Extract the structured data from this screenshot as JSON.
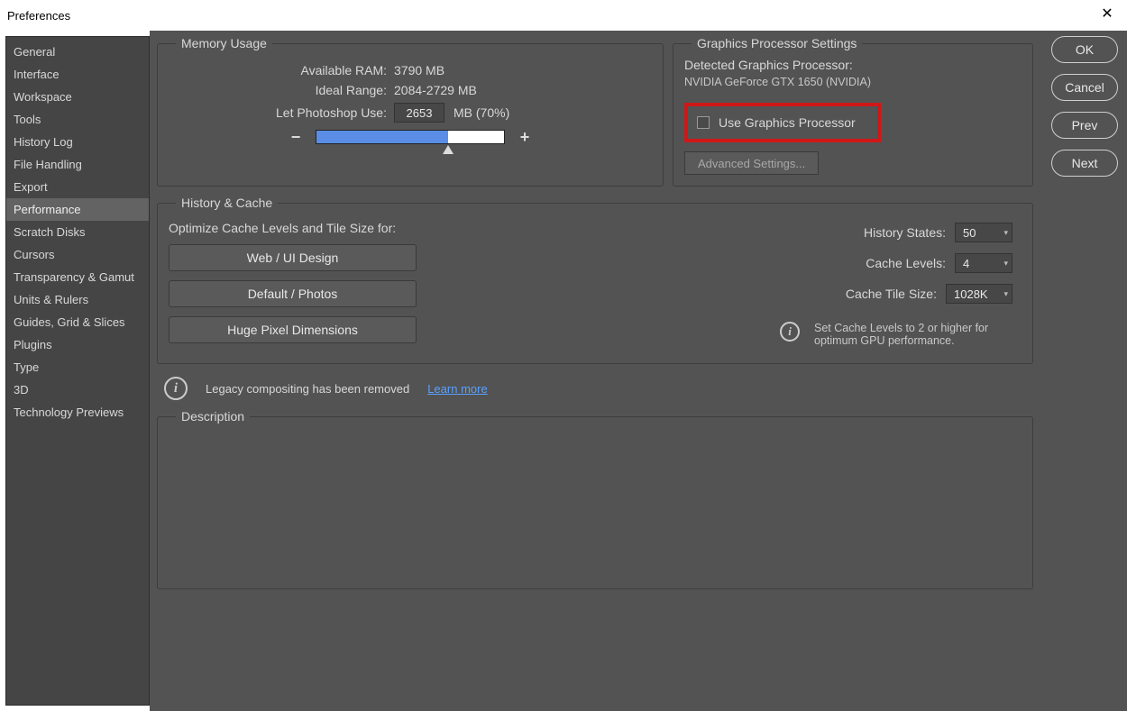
{
  "window": {
    "title": "Preferences"
  },
  "sidebar": {
    "items": [
      {
        "label": "General"
      },
      {
        "label": "Interface"
      },
      {
        "label": "Workspace"
      },
      {
        "label": "Tools"
      },
      {
        "label": "History Log"
      },
      {
        "label": "File Handling"
      },
      {
        "label": "Export"
      },
      {
        "label": "Performance",
        "selected": true
      },
      {
        "label": "Scratch Disks"
      },
      {
        "label": "Cursors"
      },
      {
        "label": "Transparency & Gamut"
      },
      {
        "label": "Units & Rulers"
      },
      {
        "label": "Guides, Grid & Slices"
      },
      {
        "label": "Plugins"
      },
      {
        "label": "Type"
      },
      {
        "label": "3D"
      },
      {
        "label": "Technology Previews"
      }
    ]
  },
  "buttons": {
    "ok": "OK",
    "cancel": "Cancel",
    "prev": "Prev",
    "next": "Next"
  },
  "memory": {
    "legend": "Memory Usage",
    "available_label": "Available RAM:",
    "available_value": "3790 MB",
    "ideal_label": "Ideal Range:",
    "ideal_value": "2084-2729 MB",
    "use_label": "Let Photoshop Use:",
    "use_value": "2653",
    "use_suffix": "MB (70%)",
    "minus": "−",
    "plus": "+"
  },
  "gpu": {
    "legend": "Graphics Processor Settings",
    "detected_label": "Detected Graphics Processor:",
    "detected_name": "NVIDIA GeForce GTX 1650 (NVIDIA)",
    "use_label": "Use Graphics Processor",
    "advanced": "Advanced Settings..."
  },
  "history_cache": {
    "legend": "History & Cache",
    "optimize_label": "Optimize Cache Levels and Tile Size for:",
    "preset1": "Web / UI Design",
    "preset2": "Default / Photos",
    "preset3": "Huge Pixel Dimensions",
    "history_states_label": "History States:",
    "history_states_value": "50",
    "cache_levels_label": "Cache Levels:",
    "cache_levels_value": "4",
    "cache_tile_label": "Cache Tile Size:",
    "cache_tile_value": "1028K",
    "hint": "Set Cache Levels to 2 or higher for optimum GPU performance."
  },
  "legacy": {
    "text": "Legacy compositing has been removed",
    "learn": "Learn more"
  },
  "description": {
    "legend": "Description"
  }
}
